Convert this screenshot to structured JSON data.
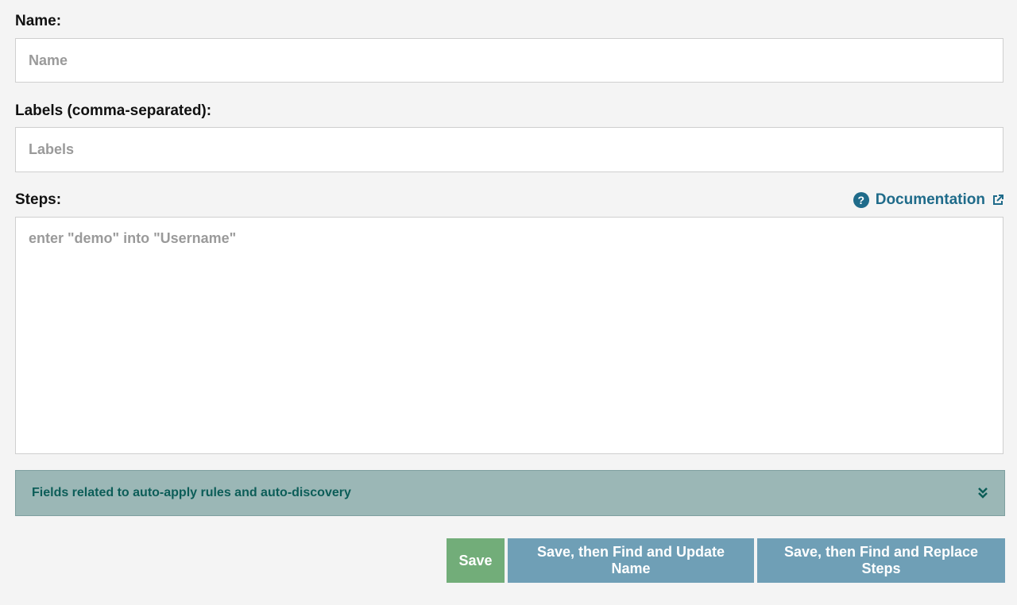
{
  "form": {
    "name_label": "Name:",
    "name_placeholder": "Name",
    "labels_label": "Labels (comma-separated):",
    "labels_placeholder": "Labels",
    "steps_label": "Steps:",
    "steps_placeholder": "enter \"demo\" into \"Username\"",
    "documentation_link": "Documentation"
  },
  "accordion": {
    "title": "Fields related to auto-apply rules and auto-discovery",
    "icon": "double-chevron-down-icon"
  },
  "actions": {
    "save_label": "Save",
    "save_update_name_label": "Save, then Find and Update Name",
    "save_replace_steps_label": "Save, then Find and Replace Steps"
  },
  "colors": {
    "save_button": "#72ad79",
    "secondary_button": "#6f9fb6",
    "accordion_bg": "#9bb7b6",
    "link": "#1f6b8a"
  }
}
